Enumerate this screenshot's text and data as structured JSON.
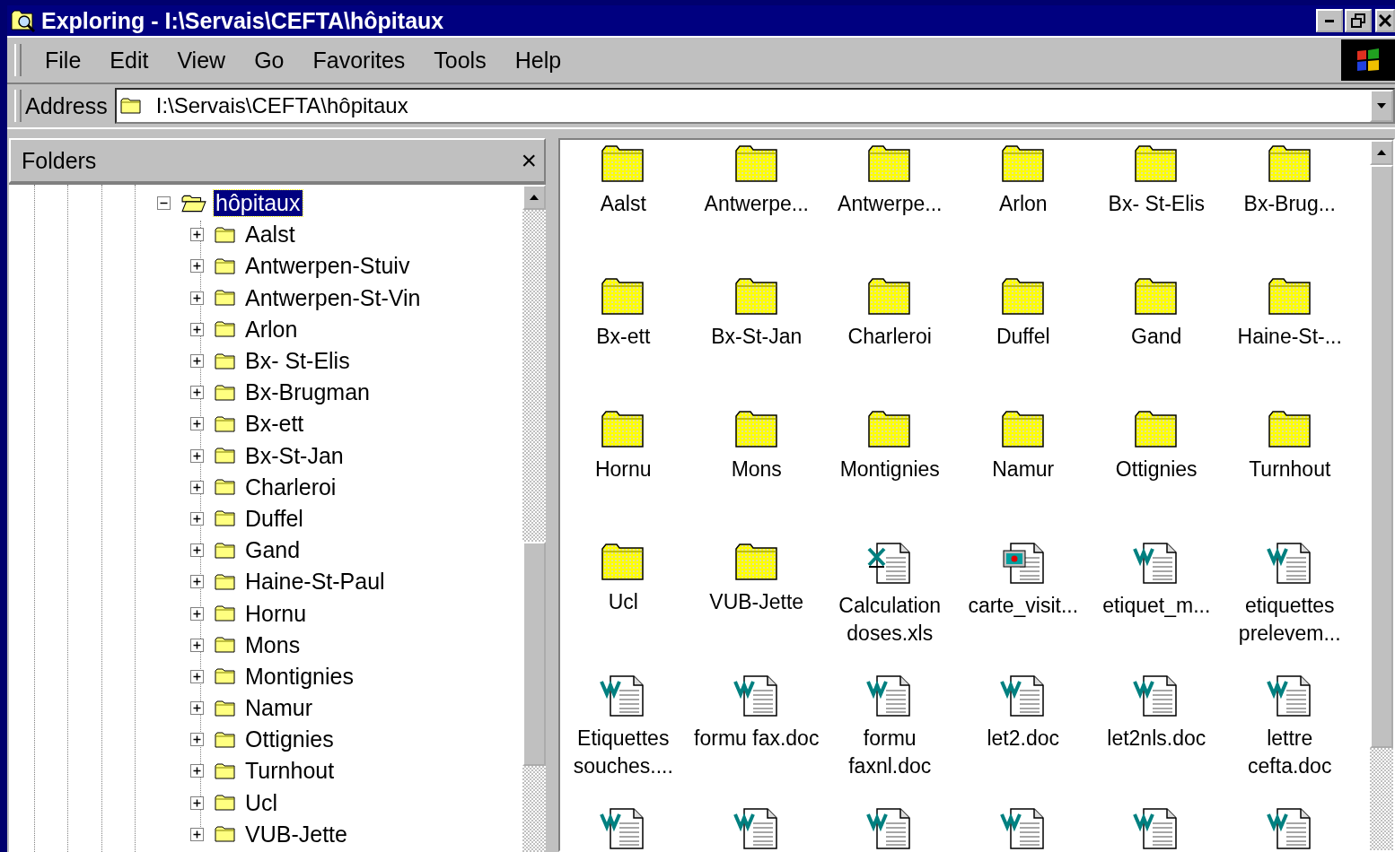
{
  "window": {
    "title": "Exploring - I:\\Servais\\CEFTA\\hôpitaux"
  },
  "menu": [
    {
      "label": "File"
    },
    {
      "label": "Edit"
    },
    {
      "label": "View"
    },
    {
      "label": "Go"
    },
    {
      "label": "Favorites"
    },
    {
      "label": "Tools"
    },
    {
      "label": "Help"
    }
  ],
  "address": {
    "label": "Address",
    "value": "I:\\Servais\\CEFTA\\hôpitaux"
  },
  "folders_pane": {
    "title": "Folders",
    "close": "×",
    "tree": {
      "label": "hôpitaux",
      "selected": true,
      "expanded": true,
      "children": [
        {
          "label": "Aalst",
          "selected": false,
          "expanded": false
        },
        {
          "label": "Antwerpen-Stuiv",
          "selected": false,
          "expanded": false
        },
        {
          "label": "Antwerpen-St-Vin",
          "selected": false,
          "expanded": false
        },
        {
          "label": "Arlon",
          "selected": false,
          "expanded": false
        },
        {
          "label": "Bx- St-Elis",
          "selected": false,
          "expanded": false
        },
        {
          "label": "Bx-Brugman",
          "selected": false,
          "expanded": false
        },
        {
          "label": "Bx-ett",
          "selected": false,
          "expanded": false
        },
        {
          "label": "Bx-St-Jan",
          "selected": false,
          "expanded": false
        },
        {
          "label": "Charleroi",
          "selected": false,
          "expanded": false
        },
        {
          "label": "Duffel",
          "selected": false,
          "expanded": false
        },
        {
          "label": "Gand",
          "selected": false,
          "expanded": false
        },
        {
          "label": "Haine-St-Paul",
          "selected": false,
          "expanded": false
        },
        {
          "label": "Hornu",
          "selected": false,
          "expanded": false
        },
        {
          "label": "Mons",
          "selected": false,
          "expanded": false
        },
        {
          "label": "Montignies",
          "selected": false,
          "expanded": false
        },
        {
          "label": "Namur",
          "selected": false,
          "expanded": false
        },
        {
          "label": "Ottignies",
          "selected": false,
          "expanded": false
        },
        {
          "label": "Turnhout",
          "selected": false,
          "expanded": false
        },
        {
          "label": "Ucl",
          "selected": false,
          "expanded": false
        },
        {
          "label": "VUB-Jette",
          "selected": false,
          "expanded": false
        }
      ]
    }
  },
  "files": [
    {
      "kind": "folder",
      "label": "Aalst"
    },
    {
      "kind": "folder",
      "label": "Antwerpe..."
    },
    {
      "kind": "folder",
      "label": "Antwerpe..."
    },
    {
      "kind": "folder",
      "label": "Arlon"
    },
    {
      "kind": "folder",
      "label": "Bx- St-Elis"
    },
    {
      "kind": "folder",
      "label": "Bx-Brug..."
    },
    {
      "kind": "folder",
      "label": "Bx-ett"
    },
    {
      "kind": "folder",
      "label": "Bx-St-Jan"
    },
    {
      "kind": "folder",
      "label": "Charleroi"
    },
    {
      "kind": "folder",
      "label": "Duffel"
    },
    {
      "kind": "folder",
      "label": "Gand"
    },
    {
      "kind": "folder",
      "label": "Haine-St-..."
    },
    {
      "kind": "folder",
      "label": "Hornu"
    },
    {
      "kind": "folder",
      "label": "Mons"
    },
    {
      "kind": "folder",
      "label": "Montignies"
    },
    {
      "kind": "folder",
      "label": "Namur"
    },
    {
      "kind": "folder",
      "label": "Ottignies"
    },
    {
      "kind": "folder",
      "label": "Turnhout"
    },
    {
      "kind": "folder",
      "label": "Ucl"
    },
    {
      "kind": "folder",
      "label": "VUB-Jette"
    },
    {
      "kind": "spreadsheet",
      "label": "Calculation doses.xls"
    },
    {
      "kind": "picture",
      "label": "carte_visit..."
    },
    {
      "kind": "document",
      "label": "etiquet_m..."
    },
    {
      "kind": "document",
      "label": "etiquettes prelevem..."
    },
    {
      "kind": "document",
      "label": "Etiquettes souches...."
    },
    {
      "kind": "document",
      "label": "formu fax.doc"
    },
    {
      "kind": "document",
      "label": "formu faxnl.doc"
    },
    {
      "kind": "document",
      "label": "let2.doc"
    },
    {
      "kind": "document",
      "label": "let2nls.doc"
    },
    {
      "kind": "document",
      "label": "lettre cefta.doc"
    },
    {
      "kind": "document"
    },
    {
      "kind": "document"
    },
    {
      "kind": "document"
    },
    {
      "kind": "document"
    },
    {
      "kind": "document"
    },
    {
      "kind": "document"
    }
  ]
}
